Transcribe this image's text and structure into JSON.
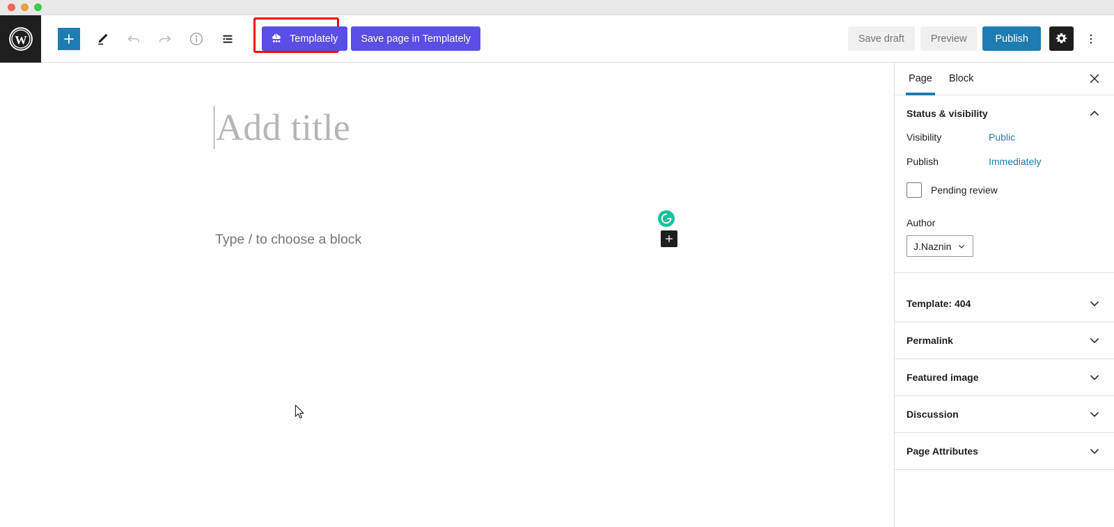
{
  "window": {
    "controls": [
      "close",
      "minimize",
      "maximize"
    ]
  },
  "toolbar": {
    "logo_name": "wordpress-logo",
    "add_block_label": "+",
    "tools": [
      {
        "name": "add-block-button",
        "label": "Add block"
      },
      {
        "name": "edit-tool-button",
        "label": "Tools"
      },
      {
        "name": "undo-button",
        "label": "Undo"
      },
      {
        "name": "redo-button",
        "label": "Redo"
      },
      {
        "name": "details-button",
        "label": "Details"
      },
      {
        "name": "list-view-button",
        "label": "List View"
      }
    ],
    "templately_label": "Templately",
    "save_in_templately_label": "Save page in Templately",
    "save_draft_label": "Save draft",
    "preview_label": "Preview",
    "publish_label": "Publish",
    "settings_label": "Settings",
    "options_label": "Options",
    "accent_blue": "#1e7cb0",
    "templately_purple": "#5b4ee6",
    "highlight_red": "#ff0000"
  },
  "canvas": {
    "title_placeholder": "Add title",
    "block_placeholder": "Type / to choose a block",
    "grammarly_label": "G",
    "inserter_label": "+"
  },
  "sidebar": {
    "tabs": [
      {
        "label": "Page",
        "active": true
      },
      {
        "label": "Block",
        "active": false
      }
    ],
    "close_label": "Close settings",
    "status_panel": {
      "title": "Status & visibility",
      "expanded": true,
      "rows": [
        {
          "label": "Visibility",
          "value": "Public"
        },
        {
          "label": "Publish",
          "value": "Immediately"
        }
      ],
      "pending_review_label": "Pending review",
      "pending_review_checked": false,
      "author_label": "Author",
      "author_value": "J.Naznin"
    },
    "panels": [
      {
        "title": "Template: 404",
        "expanded": false
      },
      {
        "title": "Permalink",
        "expanded": false
      },
      {
        "title": "Featured image",
        "expanded": false
      },
      {
        "title": "Discussion",
        "expanded": false
      },
      {
        "title": "Page Attributes",
        "expanded": false
      }
    ]
  }
}
